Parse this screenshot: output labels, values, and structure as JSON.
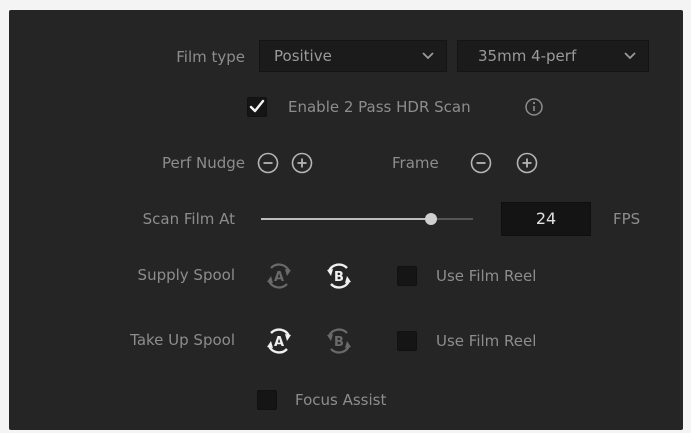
{
  "film_type": {
    "label": "Film type",
    "type_value": "Positive",
    "format_value": "35mm 4-perf"
  },
  "hdr": {
    "label": "Enable 2 Pass HDR Scan",
    "checked": true,
    "info_icon": "info-icon"
  },
  "perf_nudge": {
    "label": "Perf Nudge",
    "frame_label": "Frame"
  },
  "scan_speed": {
    "label": "Scan Film At",
    "value": "24",
    "unit": "FPS",
    "slider_fraction": 0.8
  },
  "supply_spool": {
    "label": "Supply Spool",
    "option_a": "A",
    "option_b": "B",
    "selected": "B",
    "film_reel_label": "Use Film Reel",
    "film_reel_checked": false
  },
  "takeup_spool": {
    "label": "Take Up Spool",
    "option_a": "A",
    "option_b": "B",
    "selected": "A",
    "film_reel_label": "Use Film Reel",
    "film_reel_checked": false
  },
  "focus_assist": {
    "label": "Focus Assist",
    "checked": false
  },
  "colors": {
    "panel_bg": "#252525",
    "text": "#8d8d8d",
    "active_icon": "#f0f0f0",
    "inactive_icon": "#6a6a6a"
  }
}
